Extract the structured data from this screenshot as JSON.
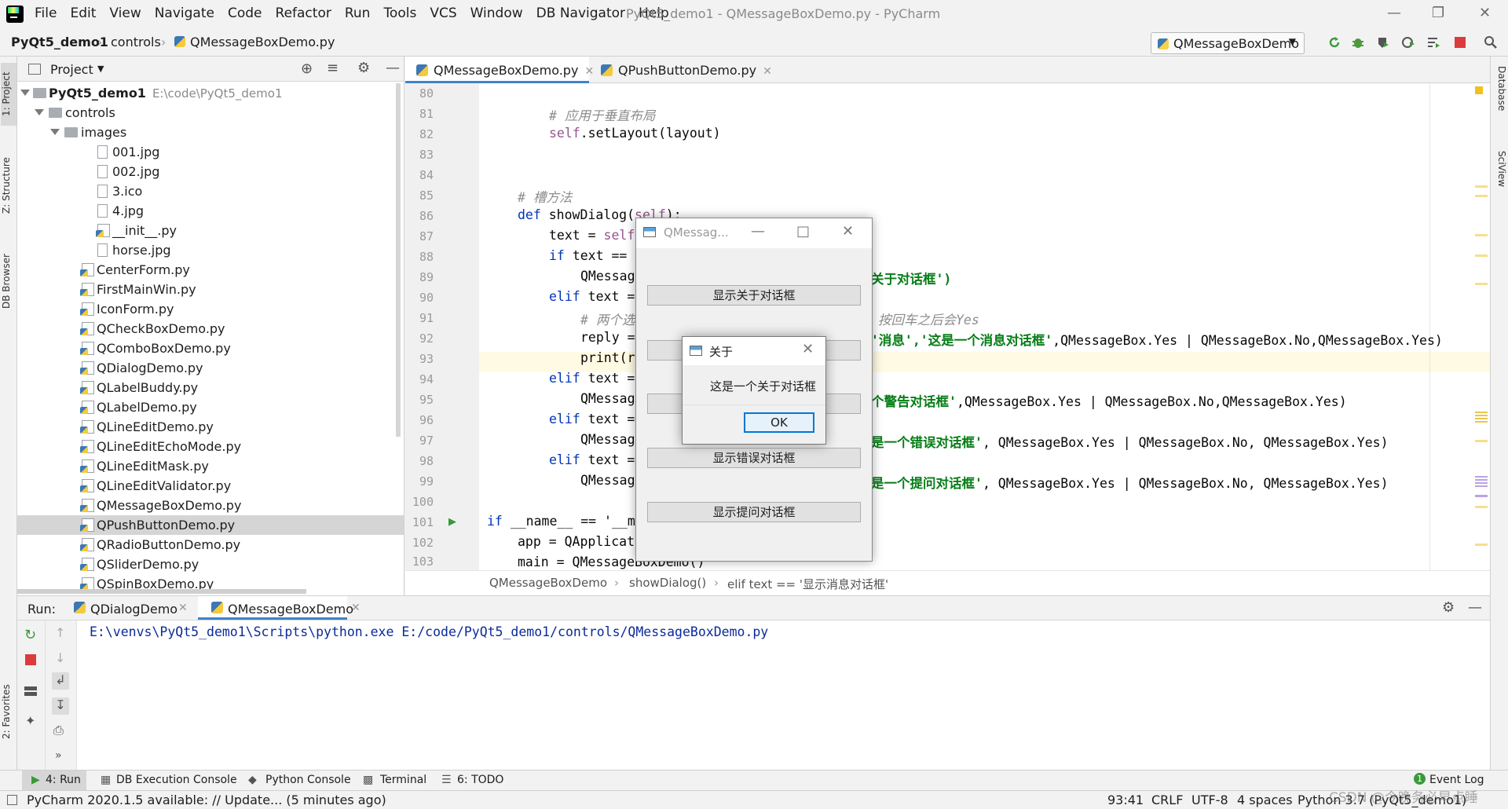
{
  "menu": {
    "items": [
      "File",
      "Edit",
      "View",
      "Navigate",
      "Code",
      "Refactor",
      "Run",
      "Tools",
      "VCS",
      "Window",
      "DB Navigator",
      "Help"
    ],
    "window_title": "PyQt5_demo1 - QMessageBoxDemo.py - PyCharm"
  },
  "nav": {
    "project": "PyQt5_demo1",
    "folder": "controls",
    "file": "QMessageBoxDemo.py",
    "run_config": "QMessageBoxDemo"
  },
  "left_strip": {
    "project": "1: Project",
    "structure": "Z: Structure",
    "db_browser": "DB Browser",
    "favorites": "2: Favorites"
  },
  "right_strip": {
    "database": "Database",
    "sciview": "SciView"
  },
  "project_panel": {
    "title": "Project",
    "root_name": "PyQt5_demo1",
    "root_path": "E:\\code\\PyQt5_demo1",
    "folder_controls": "controls",
    "folder_images": "images",
    "image_files": [
      "001.jpg",
      "002.jpg",
      "3.ico",
      "4.jpg",
      "__init__.py",
      "horse.jpg"
    ],
    "py_files": [
      "CenterForm.py",
      "FirstMainWin.py",
      "IconForm.py",
      "QCheckBoxDemo.py",
      "QComboBoxDemo.py",
      "QDialogDemo.py",
      "QLabelBuddy.py",
      "QLabelDemo.py",
      "QLineEditDemo.py",
      "QLineEditEchoMode.py",
      "QLineEditMask.py",
      "QLineEditValidator.py",
      "QMessageBoxDemo.py",
      "QPushButtonDemo.py",
      "QRadioButtonDemo.py",
      "QSliderDemo.py",
      "QSpinBoxDemo.py"
    ],
    "selected": "QPushButtonDemo.py"
  },
  "editor": {
    "tabs": [
      "QMessageBoxDemo.py",
      "QPushButtonDemo.py"
    ],
    "active_tab": "QMessageBoxDemo.py",
    "line_numbers": [
      "80",
      "81",
      "82",
      "83",
      "84",
      "85",
      "86",
      "87",
      "88",
      "89",
      "90",
      "91",
      "92",
      "93",
      "94",
      "95",
      "96",
      "97",
      "98",
      "99",
      "100",
      "101",
      "102",
      "103"
    ],
    "lines": {
      "l81": "# 应用于垂直布局",
      "l82a": "self",
      "l82b": ".setLayout(layout)",
      "l85": "# 槽方法",
      "l86a": "def ",
      "l86b": "showDialog(",
      "l86c": "self",
      "l86d": "):",
      "l87a": "text = ",
      "l87b": "self",
      "l88a": "if ",
      "l88b": "text ==",
      "l89a": "QMessag",
      "l89b": "关于对话框')",
      "l90a": "elif ",
      "l90b": "text =",
      "l91a": "# 两个选",
      "l91b": "按回车之后会Yes",
      "l92a": "reply =",
      "l92b": "'消息','这是一个消息对话框'",
      "l92c": ",QMessageBox.Yes | QMessageBox.No,QMessageBox.Yes)",
      "l93a": "print(r",
      "l94a": "elif ",
      "l94b": "text =",
      "l95a": "QMessag",
      "l95b": "个警告对话框'",
      "l95c": ",QMessageBox.Yes | QMessageBox.No,QMessageBox.Yes)",
      "l96a": "elif ",
      "l96b": "text =",
      "l97a": "QMessag",
      "l97b": "是一个错误对话框'",
      "l97c": ", QMessageBox.Yes | QMessageBox.No, QMessageBox.Yes)",
      "l98a": "elif ",
      "l98b": "text =",
      "l99a": "QMessag",
      "l99b": "是一个提问对话框'",
      "l99c": ", QMessageBox.Yes | QMessageBox.No, QMessageBox.Yes)",
      "l101a": "if ",
      "l101b": "__name__ == '__m",
      "l102": "app = QApplicat",
      "l103": "main = QMessageBoxDemo()"
    },
    "breadcrumb": [
      "QMessageBoxDemo",
      "showDialog()",
      "elif text == '显示消息对话框'"
    ]
  },
  "qmessagebox_window": {
    "title": "QMessag...",
    "buttons": [
      "显示关于对话框",
      "",
      "",
      "显示错误对话框",
      "显示提问对话框"
    ]
  },
  "about_dialog": {
    "title": "关于",
    "message": "这是一个关于对话框",
    "ok_label": "OK"
  },
  "run_panel": {
    "label": "Run:",
    "tabs": [
      "QDialogDemo",
      "QMessageBoxDemo"
    ],
    "command": "E:\\venvs\\PyQt5_demo1\\Scripts\\python.exe E:/code/PyQt5_demo1/controls/QMessageBoxDemo.py"
  },
  "bottom_tools": {
    "run": "4: Run",
    "db_console": "DB Execution Console",
    "python_console": "Python Console",
    "terminal": "Terminal",
    "todo": "6: TODO",
    "event_log": "Event Log",
    "event_count": "1"
  },
  "status": {
    "message": "PyCharm 2020.1.5 available: // Update... (5 minutes ago)",
    "position": "93:41",
    "line_sep": "CRLF",
    "encoding": "UTF-8",
    "indent": "4 spaces",
    "interpreter": "Python 3.7 (PyQt5_demo1)",
    "watermark": "CSDN @今晚务必早点睡"
  },
  "colors": {
    "accent": "#4083c9",
    "keyword": "#0033b3",
    "string": "#067d17",
    "self": "#94558d"
  }
}
